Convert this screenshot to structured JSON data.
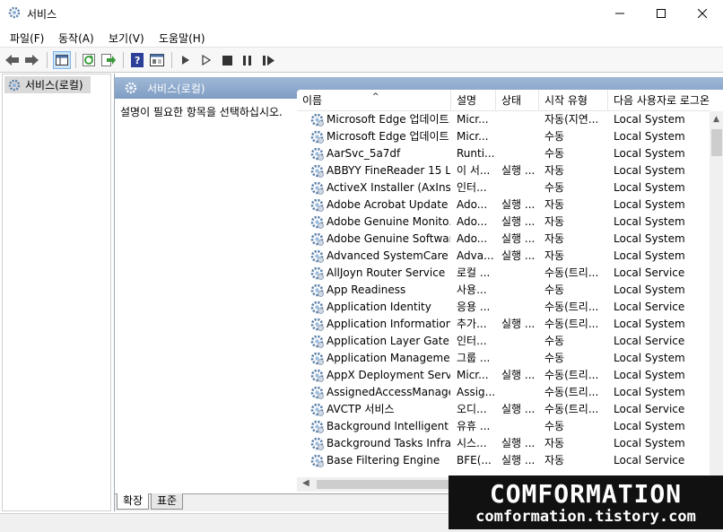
{
  "window": {
    "title": "서비스"
  },
  "menu": [
    "파일(F)",
    "동작(A)",
    "보기(V)",
    "도움말(H)"
  ],
  "tree": {
    "root_label": "서비스(로컬)"
  },
  "pane": {
    "header": "서비스(로컬)",
    "description_prompt": "설명이 필요한 항목을 선택하십시오."
  },
  "columns": {
    "name": "이름",
    "description": "설명",
    "status": "상태",
    "startup_type": "시작 유형",
    "logon_as": "다음 사용자로 로그온"
  },
  "services": [
    {
      "name": "Microsoft Edge 업데이트...",
      "description": "Micr...",
      "status": "",
      "startup_type": "자동(지연...",
      "logon_as": "Local System"
    },
    {
      "name": "Microsoft Edge 업데이트...",
      "description": "Micr...",
      "status": "",
      "startup_type": "수동",
      "logon_as": "Local System"
    },
    {
      "name": "AarSvc_5a7df",
      "description": "Runti...",
      "status": "",
      "startup_type": "수동",
      "logon_as": "Local System"
    },
    {
      "name": "ABBYY FineReader 15 Li...",
      "description": "이 서...",
      "status": "실행 ...",
      "startup_type": "자동",
      "logon_as": "Local System"
    },
    {
      "name": "ActiveX Installer (AxInst...",
      "description": "인터...",
      "status": "",
      "startup_type": "수동",
      "logon_as": "Local System"
    },
    {
      "name": "Adobe Acrobat Update ...",
      "description": "Ado...",
      "status": "실행 ...",
      "startup_type": "자동",
      "logon_as": "Local System"
    },
    {
      "name": "Adobe Genuine Monito...",
      "description": "Ado...",
      "status": "실행 ...",
      "startup_type": "자동",
      "logon_as": "Local System"
    },
    {
      "name": "Adobe Genuine Softwar...",
      "description": "Ado...",
      "status": "실행 ...",
      "startup_type": "자동",
      "logon_as": "Local System"
    },
    {
      "name": "Advanced SystemCare ...",
      "description": "Adva...",
      "status": "실행 ...",
      "startup_type": "자동",
      "logon_as": "Local System"
    },
    {
      "name": "AllJoyn Router Service",
      "description": "로컬 ...",
      "status": "",
      "startup_type": "수동(트리...",
      "logon_as": "Local Service"
    },
    {
      "name": "App Readiness",
      "description": "사용...",
      "status": "",
      "startup_type": "수동",
      "logon_as": "Local System"
    },
    {
      "name": "Application Identity",
      "description": "응용 ...",
      "status": "",
      "startup_type": "수동(트리...",
      "logon_as": "Local Service"
    },
    {
      "name": "Application Information",
      "description": "추가...",
      "status": "실행 ...",
      "startup_type": "수동(트리...",
      "logon_as": "Local System"
    },
    {
      "name": "Application Layer Gate...",
      "description": "인터...",
      "status": "",
      "startup_type": "수동",
      "logon_as": "Local Service"
    },
    {
      "name": "Application Management",
      "description": "그룹 ...",
      "status": "",
      "startup_type": "수동",
      "logon_as": "Local System"
    },
    {
      "name": "AppX Deployment Servi...",
      "description": "Micr...",
      "status": "실행 ...",
      "startup_type": "수동(트리...",
      "logon_as": "Local System"
    },
    {
      "name": "AssignedAccessManage...",
      "description": "Assig...",
      "status": "",
      "startup_type": "수동(트리...",
      "logon_as": "Local System"
    },
    {
      "name": "AVCTP 서비스",
      "description": "오디...",
      "status": "실행 ...",
      "startup_type": "수동(트리...",
      "logon_as": "Local Service"
    },
    {
      "name": "Background Intelligent ...",
      "description": "유휴 ...",
      "status": "",
      "startup_type": "수동",
      "logon_as": "Local System"
    },
    {
      "name": "Background Tasks Infras...",
      "description": "시스...",
      "status": "실행 ...",
      "startup_type": "자동",
      "logon_as": "Local System"
    },
    {
      "name": "Base Filtering Engine",
      "description": "BFE(...",
      "status": "실행 ...",
      "startup_type": "자동",
      "logon_as": "Local Service"
    }
  ],
  "tabs": [
    "확장",
    "표준"
  ],
  "watermark": {
    "title": "COMFORMATION",
    "url": "comformation.tistory.com"
  },
  "icons": {
    "app": "gear-icon",
    "minimize": "minimize-icon",
    "maximize": "maximize-icon",
    "close": "close-icon",
    "toolbar": [
      "back-arrow-icon",
      "forward-arrow-icon",
      "console-tree-icon",
      "refresh-icon",
      "export-icon",
      "help-icon",
      "properties-icon",
      "start-icon",
      "start-outline-icon",
      "stop-icon",
      "pause-icon",
      "restart-icon"
    ]
  },
  "colors": {
    "pane_header": "#8aa7cc",
    "selected_tree": "#d9d9d9",
    "watermark_bg": "#111111"
  }
}
